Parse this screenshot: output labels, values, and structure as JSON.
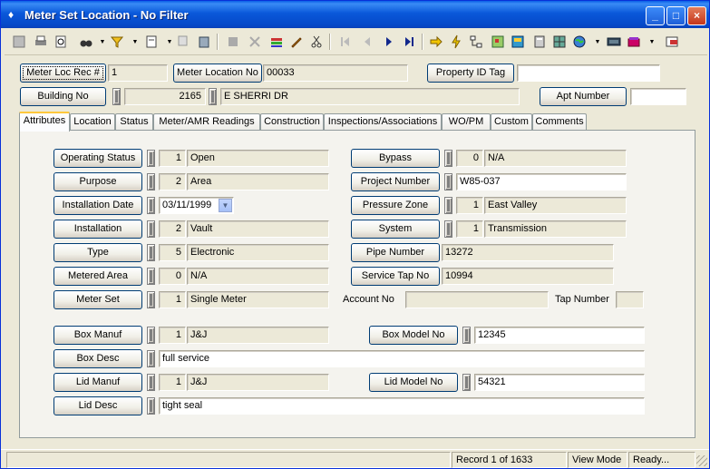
{
  "window": {
    "title": "Meter Set Location - No Filter"
  },
  "controls": {
    "minimize": "_",
    "maximize": "□",
    "close": "×"
  },
  "toolbar": {
    "icons": [
      "list-icon",
      "print-icon",
      "print-preview-icon",
      "binoculars-icon",
      "filter-icon",
      "page-icon",
      "copy-icon",
      "paste-icon",
      "stop-icon",
      "delete-icon",
      "stack-icon",
      "pencil-icon",
      "cut-icon",
      "first-record-icon",
      "previous-record-icon",
      "next-record-icon",
      "last-record-icon",
      "arrow-right-icon",
      "lightning-icon",
      "hierarchy-icon",
      "map-icon",
      "calculator-icon",
      "map-grid-icon",
      "globe-icon",
      "keyboard-icon",
      "books-icon",
      "exit-icon"
    ]
  },
  "header": {
    "meter_loc_rec_label": "Meter Loc Rec #",
    "meter_loc_rec_value": "1",
    "meter_location_no_label": "Meter Location No",
    "meter_location_no_value": "00033",
    "property_id_tag_label": "Property ID Tag",
    "property_id_tag_value": "",
    "building_no_label": "Building No",
    "building_no_value": "2165",
    "street_value": "E SHERRI DR",
    "apt_number_label": "Apt Number",
    "apt_number_value": ""
  },
  "tabs": [
    "Attributes",
    "Location",
    "Status",
    "Meter/AMR Readings",
    "Construction",
    "Inspections/Associations",
    "WO/PM",
    "Custom",
    "Comments"
  ],
  "attributes": {
    "operating_status": {
      "label": "Operating Status",
      "code": "1",
      "desc": "Open"
    },
    "purpose": {
      "label": "Purpose",
      "code": "2",
      "desc": "Area"
    },
    "installation_date": {
      "label": "Installation Date",
      "value": "03/11/1999"
    },
    "installation": {
      "label": "Installation",
      "code": "2",
      "desc": "Vault"
    },
    "type": {
      "label": "Type",
      "code": "5",
      "desc": "Electronic"
    },
    "metered_area": {
      "label": "Metered Area",
      "code": "0",
      "desc": "N/A"
    },
    "meter_set": {
      "label": "Meter Set",
      "code": "1",
      "desc": "Single Meter"
    },
    "bypass": {
      "label": "Bypass",
      "code": "0",
      "desc": "N/A"
    },
    "project_number": {
      "label": "Project Number",
      "value": "W85-037"
    },
    "pressure_zone": {
      "label": "Pressure Zone",
      "code": "1",
      "desc": "East Valley"
    },
    "system": {
      "label": "System",
      "code": "1",
      "desc": "Transmission"
    },
    "pipe_number": {
      "label": "Pipe Number",
      "value": "13272"
    },
    "service_tap_no": {
      "label": "Service Tap No",
      "value": "10994"
    },
    "account_no": {
      "label": "Account No",
      "value": ""
    },
    "tap_number": {
      "label": "Tap Number",
      "value": ""
    },
    "box_manuf": {
      "label": "Box Manuf",
      "code": "1",
      "desc": "J&J"
    },
    "box_model_no": {
      "label": "Box Model No",
      "value": "12345"
    },
    "box_desc": {
      "label": "Box Desc",
      "value": "full service"
    },
    "lid_manuf": {
      "label": "Lid Manuf",
      "code": "1",
      "desc": "J&J"
    },
    "lid_model_no": {
      "label": "Lid Model No",
      "value": "54321"
    },
    "lid_desc": {
      "label": "Lid Desc",
      "value": "tight seal"
    }
  },
  "status": {
    "record": "Record 1 of 1633",
    "mode": "View Mode",
    "state": "Ready..."
  },
  "colors": {
    "title_bar": "#0A58DA",
    "face": "#ECE9D8",
    "tab_highlight": "#FFC83C"
  }
}
